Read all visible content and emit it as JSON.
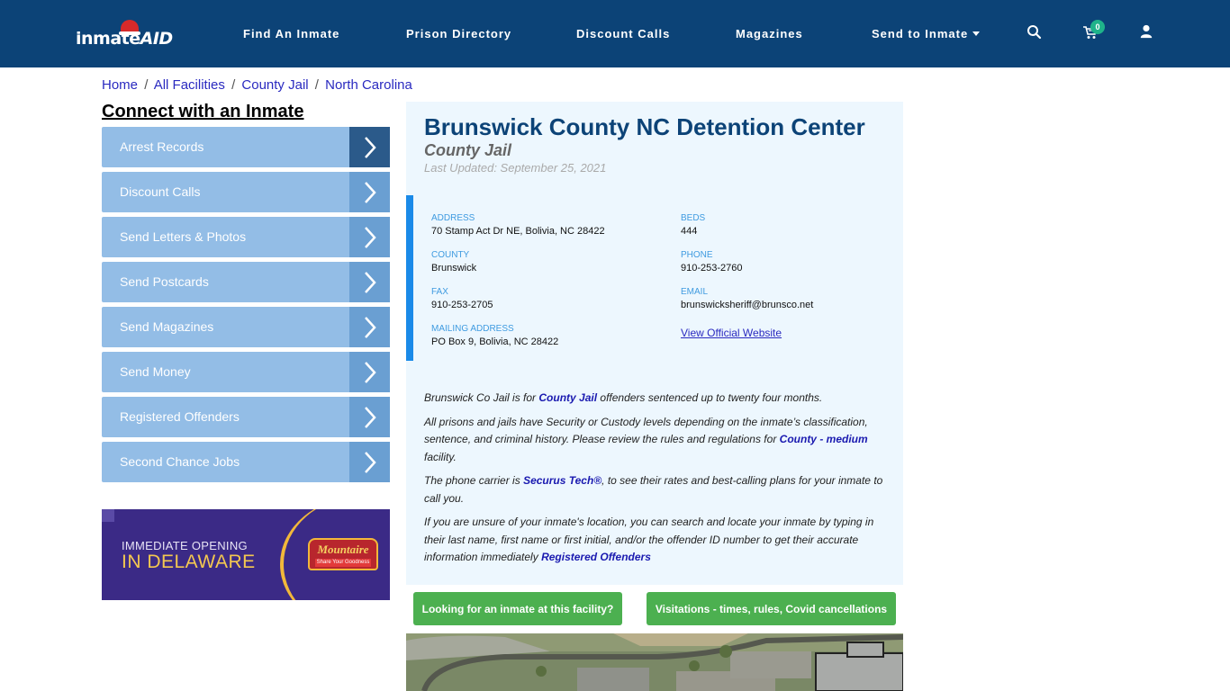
{
  "navbar": {
    "logo_text": "inmate",
    "logo_text_accent": "AID",
    "items": [
      {
        "label": "Find An Inmate"
      },
      {
        "label": "Prison Directory"
      },
      {
        "label": "Discount Calls"
      },
      {
        "label": "Magazines"
      },
      {
        "label": "Send to Inmate"
      }
    ],
    "cart_count": "0",
    "icons": [
      "search-icon",
      "cart-icon",
      "user-icon"
    ]
  },
  "breadcrumb": [
    {
      "label": "Home"
    },
    {
      "label": "All Facilities"
    },
    {
      "label": "County Jail"
    },
    {
      "label": "North Carolina"
    }
  ],
  "breadcrumb_separator": "/",
  "sidebar": {
    "title": "Connect with an Inmate",
    "items": [
      {
        "label": "Arrest Records"
      },
      {
        "label": "Discount Calls"
      },
      {
        "label": "Send Letters & Photos"
      },
      {
        "label": "Send Postcards"
      },
      {
        "label": "Send Magazines"
      },
      {
        "label": "Send Money"
      },
      {
        "label": "Registered Offenders"
      },
      {
        "label": "Second Chance Jobs"
      }
    ]
  },
  "ad": {
    "line1": "IMMEDIATE OPENING",
    "line2": "IN DELAWARE",
    "brand": "Mountaire",
    "tagline": "Share Your Goodness"
  },
  "facility": {
    "name": "Brunswick County NC Detention Center",
    "type": "County Jail",
    "last_updated": "Last Updated: September 25, 2021",
    "fields": {
      "address": {
        "label": "ADDRESS",
        "value": "70 Stamp Act Dr NE, Bolivia, NC 28422"
      },
      "beds": {
        "label": "BEDS",
        "value": "444"
      },
      "county": {
        "label": "COUNTY",
        "value": "Brunswick"
      },
      "phone": {
        "label": "PHONE",
        "value": "910-253-2760"
      },
      "fax": {
        "label": "FAX",
        "value": "910-253-2705"
      },
      "email": {
        "label": "EMAIL",
        "value": "brunswicksheriff@brunsco.net"
      },
      "mailing": {
        "label": "MAILING ADDRESS",
        "value": "PO Box 9, Bolivia, NC 28422"
      }
    },
    "website_link": "View Official Website"
  },
  "description": {
    "p1_a": "Brunswick Co Jail is for ",
    "p1_link": "County Jail",
    "p1_b": " offenders sentenced up to twenty four months.",
    "p2_a": "All prisons and jails have Security or Custody levels depending on the inmate’s classification, sentence, and criminal history. Please review the rules and regulations for ",
    "p2_link": "County - medium",
    "p2_b": " facility.",
    "p3_a": "The phone carrier is ",
    "p3_link": "Securus Tech®",
    "p3_b": ", to see their rates and best-calling plans for your inmate to call you.",
    "p4_a": "If you are unsure of your inmate's location, you can search and locate your inmate by typing in their last name, first name or first initial, and/or the offender ID number to get their accurate information immediately ",
    "p4_link": "Registered Offenders"
  },
  "buttons": {
    "find_inmate": "Looking for an inmate at this facility?",
    "visitations": "Visitations - times, rules, Covid cancellations"
  }
}
